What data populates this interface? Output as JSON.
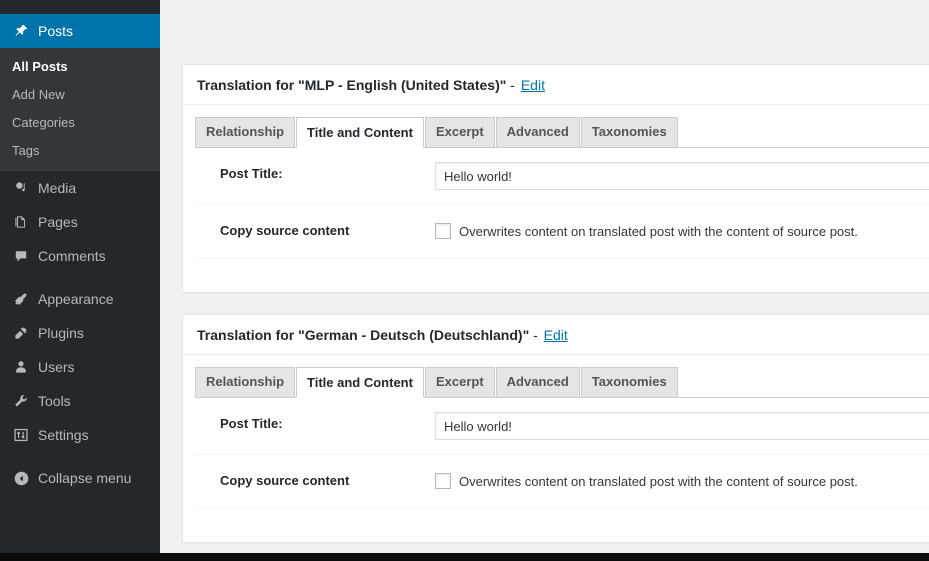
{
  "sidebar": {
    "items": [
      {
        "label": "Posts",
        "icon": "pin-icon",
        "current": true,
        "submenu": [
          {
            "label": "All Posts",
            "current": true
          },
          {
            "label": "Add New",
            "current": false
          },
          {
            "label": "Categories",
            "current": false
          },
          {
            "label": "Tags",
            "current": false
          }
        ]
      },
      {
        "label": "Media",
        "icon": "media-icon",
        "current": false
      },
      {
        "label": "Pages",
        "icon": "pages-icon",
        "current": false
      },
      {
        "label": "Comments",
        "icon": "comments-icon",
        "current": false
      },
      {
        "label": "Appearance",
        "icon": "appearance-icon",
        "current": false
      },
      {
        "label": "Plugins",
        "icon": "plugins-icon",
        "current": false
      },
      {
        "label": "Users",
        "icon": "users-icon",
        "current": false
      },
      {
        "label": "Tools",
        "icon": "tools-icon",
        "current": false
      },
      {
        "label": "Settings",
        "icon": "settings-icon",
        "current": false
      },
      {
        "label": "Collapse menu",
        "icon": "collapse-icon",
        "current": false
      }
    ]
  },
  "colors": {
    "admin_bg": "#23282d",
    "submenu_bg": "#32373c",
    "accent_blue": "#0073aa",
    "content_bg": "#f1f1f1",
    "link": "#0073aa"
  },
  "panels": [
    {
      "title_prefix": "Translation for \"MLP - English (United States)\"",
      "title_dash": " - ",
      "edit_label": "Edit",
      "tabs": [
        {
          "label": "Relationship",
          "active": false
        },
        {
          "label": "Title and Content",
          "active": true
        },
        {
          "label": "Excerpt",
          "active": false
        },
        {
          "label": "Advanced",
          "active": false
        },
        {
          "label": "Taxonomies",
          "active": false
        }
      ],
      "fields": {
        "post_title_label": "Post Title:",
        "post_title_value": "Hello world!",
        "post_title_placeholder": "",
        "copy_source_label": "Copy source content",
        "copy_source_checkbox_label": "Overwrites content on translated post with the content of source post.",
        "copy_source_checked": false
      }
    },
    {
      "title_prefix": "Translation for \"German - Deutsch (Deutschland)\"",
      "title_dash": " - ",
      "edit_label": "Edit",
      "tabs": [
        {
          "label": "Relationship",
          "active": false
        },
        {
          "label": "Title and Content",
          "active": true
        },
        {
          "label": "Excerpt",
          "active": false
        },
        {
          "label": "Advanced",
          "active": false
        },
        {
          "label": "Taxonomies",
          "active": false
        }
      ],
      "fields": {
        "post_title_label": "Post Title:",
        "post_title_value": "Hello world!",
        "post_title_placeholder": "",
        "copy_source_label": "Copy source content",
        "copy_source_checkbox_label": "Overwrites content on translated post with the content of source post.",
        "copy_source_checked": false
      }
    }
  ]
}
